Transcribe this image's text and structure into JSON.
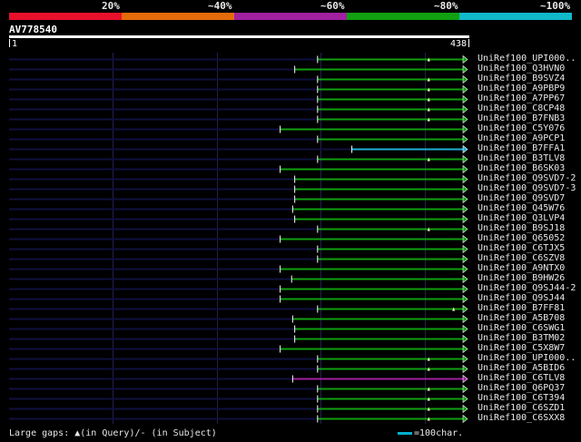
{
  "header": {
    "pct_labels": [
      "20%",
      "~40%",
      "~60%",
      "~80%",
      "~100%"
    ],
    "band_colors": [
      "#e8102a",
      "#e46a0a",
      "#a020a0",
      "#10a010",
      "#10b8c8"
    ]
  },
  "query": {
    "name": "AV778540",
    "start": "1",
    "end": "438",
    "length": 438
  },
  "colors": {
    "green": "#10a010",
    "cyan": "#20b0d0",
    "purple": "#a020a0",
    "dark_line": "#101040",
    "grid": "#202050"
  },
  "hits": [
    {
      "name": "UniRef100_UPI000..",
      "start": 298,
      "color": "green",
      "tri": 405
    },
    {
      "name": "UniRef100_Q3HVN0",
      "start": 276,
      "color": "green",
      "tri": null
    },
    {
      "name": "UniRef100_B9SVZ4",
      "start": 298,
      "color": "green",
      "tri": 405
    },
    {
      "name": "UniRef100_A9PBP9",
      "start": 298,
      "color": "green",
      "tri": 405
    },
    {
      "name": "UniRef100_A7PP67",
      "start": 298,
      "color": "green",
      "tri": 405
    },
    {
      "name": "UniRef100_C8CP48",
      "start": 298,
      "color": "green",
      "tri": 405
    },
    {
      "name": "UniRef100_B7FNB3",
      "start": 298,
      "color": "green",
      "tri": 405
    },
    {
      "name": "UniRef100_C5Y076",
      "start": 262,
      "color": "green",
      "tri": null
    },
    {
      "name": "UniRef100_A9PCP1",
      "start": 298,
      "color": "green",
      "tri": null
    },
    {
      "name": "UniRef100_B7FFA1",
      "start": 331,
      "color": "cyan",
      "tri": null
    },
    {
      "name": "UniRef100_B3TLV8",
      "start": 298,
      "color": "green",
      "tri": 405
    },
    {
      "name": "UniRef100_B6SK03",
      "start": 262,
      "color": "green",
      "tri": null
    },
    {
      "name": "UniRef100_Q9SVD7-2",
      "start": 276,
      "color": "green",
      "tri": null
    },
    {
      "name": "UniRef100_Q9SVD7-3",
      "start": 276,
      "color": "green",
      "tri": null
    },
    {
      "name": "UniRef100_Q9SVD7",
      "start": 276,
      "color": "green",
      "tri": null
    },
    {
      "name": "UniRef100_Q45W76",
      "start": 274,
      "color": "green",
      "tri": null
    },
    {
      "name": "UniRef100_Q3LVP4",
      "start": 276,
      "color": "green",
      "tri": null
    },
    {
      "name": "UniRef100_B9SJ18",
      "start": 298,
      "color": "green",
      "tri": 405
    },
    {
      "name": "UniRef100_Q65052",
      "start": 262,
      "color": "green",
      "tri": null
    },
    {
      "name": "UniRef100_C6TJX5",
      "start": 298,
      "color": "green",
      "tri": null
    },
    {
      "name": "UniRef100_C6SZV8",
      "start": 298,
      "color": "green",
      "tri": null
    },
    {
      "name": "UniRef100_A9NTX0",
      "start": 262,
      "color": "green",
      "tri": null
    },
    {
      "name": "UniRef100_B9HW26",
      "start": 273,
      "color": "green",
      "tri": null
    },
    {
      "name": "UniRef100_Q9SJ44-2",
      "start": 262,
      "color": "green",
      "tri": null
    },
    {
      "name": "UniRef100_Q9SJ44",
      "start": 262,
      "color": "green",
      "tri": null
    },
    {
      "name": "UniRef100_B7FF81",
      "start": 298,
      "color": "green",
      "tri": 429
    },
    {
      "name": "UniRef100_A5B708",
      "start": 274,
      "color": "green",
      "tri": null
    },
    {
      "name": "UniRef100_C6SWG1",
      "start": 276,
      "color": "green",
      "tri": null
    },
    {
      "name": "UniRef100_B3TM02",
      "start": 276,
      "color": "green",
      "tri": null
    },
    {
      "name": "UniRef100_C5X8W7",
      "start": 262,
      "color": "green",
      "tri": null
    },
    {
      "name": "UniRef100_UPI000..",
      "start": 298,
      "color": "green",
      "tri": 405
    },
    {
      "name": "UniRef100_A5BID6",
      "start": 298,
      "color": "green",
      "tri": 405
    },
    {
      "name": "UniRef100_C6TLV8",
      "start": 274,
      "color": "purple",
      "tri": null
    },
    {
      "name": "UniRef100_Q6PQ37",
      "start": 298,
      "color": "green",
      "tri": 405
    },
    {
      "name": "UniRef100_C6T394",
      "start": 298,
      "color": "green",
      "tri": 405
    },
    {
      "name": "UniRef100_C6SZD1",
      "start": 298,
      "color": "green",
      "tri": 405
    },
    {
      "name": "UniRef100_C6SXX8",
      "start": 298,
      "color": "green",
      "tri": 405
    }
  ],
  "legend": {
    "gaps_text": "Large gaps: ▲(in Query)/- (in Subject)",
    "scale_text": "=100char."
  }
}
